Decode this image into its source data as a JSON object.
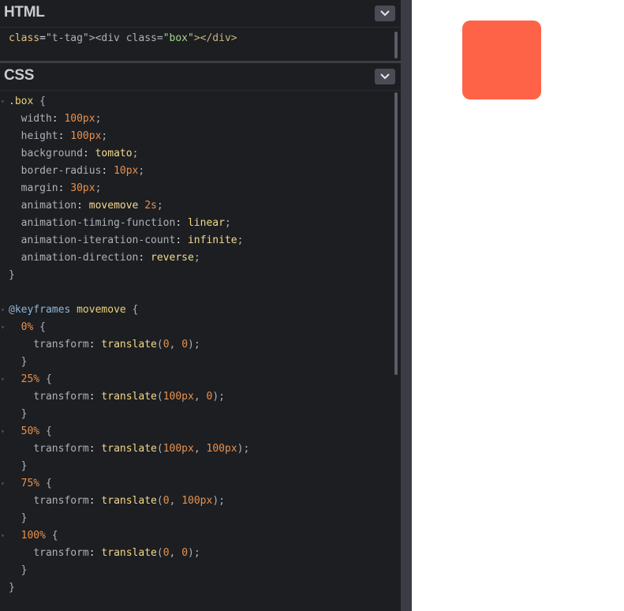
{
  "html_panel": {
    "title": "HTML",
    "code": "<div class=\"box\"></div>"
  },
  "css_panel": {
    "title": "CSS",
    "lines": [
      ".box {",
      "  width: 100px;",
      "  height: 100px;",
      "  background: tomato;",
      "  border-radius: 10px;",
      "  margin: 30px;",
      "  animation: movemove 2s;",
      "  animation-timing-function: linear;",
      "  animation-iteration-count: infinite;",
      "  animation-direction: reverse;",
      "}",
      "",
      "@keyframes movemove {",
      "  0% {",
      "    transform: translate(0, 0);",
      "  }",
      "  25% {",
      "    transform: translate(100px, 0);",
      "  }",
      "  50% {",
      "    transform: translate(100px, 100px);",
      "  }",
      "  75% {",
      "    transform: translate(0, 100px);",
      "  }",
      "  100% {",
      "    transform: translate(0, 0);",
      "  }",
      "}"
    ]
  },
  "preview": {
    "box_color": "#ff6347"
  },
  "colors": {
    "editor_bg": "#1d1e22",
    "divider": "#3b3d45"
  },
  "icons": {
    "collapse": "chevron-down-icon"
  }
}
